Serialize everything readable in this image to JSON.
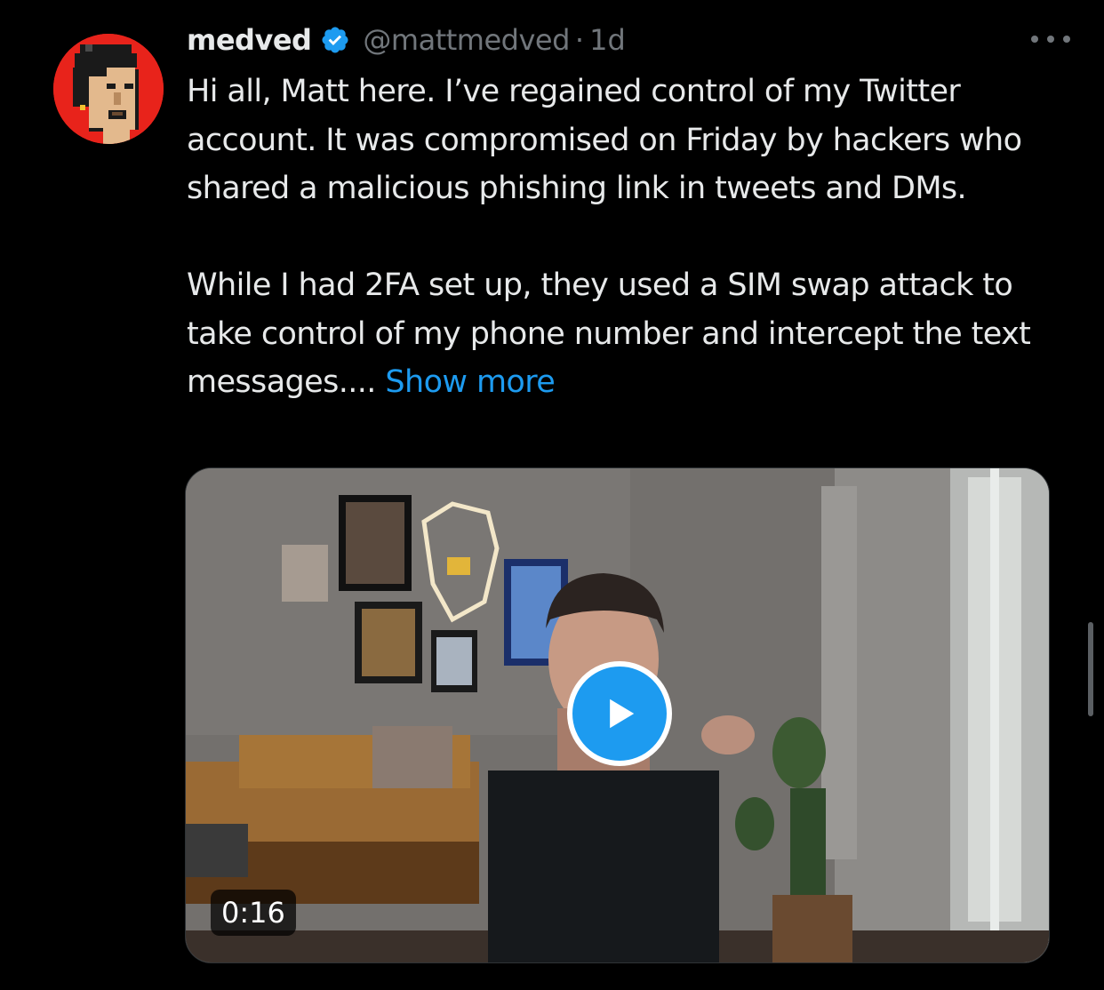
{
  "tweet": {
    "author": {
      "display_name": "medved",
      "handle": "@mattmedved",
      "verified": true
    },
    "separator": "·",
    "age": "1d",
    "paragraphs": [
      "Hi all, Matt here. I’ve regained control of my Twitter account. It was compromised on Friday by hackers who shared a malicious phishing link in tweets and DMs.",
      "While I had 2FA set up, they used a SIM swap attack to take control of my phone number and intercept the text messages...."
    ],
    "show_more_label": "Show more",
    "video": {
      "duration": "0:16"
    }
  },
  "colors": {
    "background": "#000000",
    "text": "#e7e9ea",
    "secondary_text": "#71767b",
    "accent": "#1d9bf0",
    "avatar_bg": "#e8231b"
  },
  "icons": {
    "verified": "verified-badge-icon",
    "more": "more-horizontal-icon",
    "play": "play-icon"
  }
}
